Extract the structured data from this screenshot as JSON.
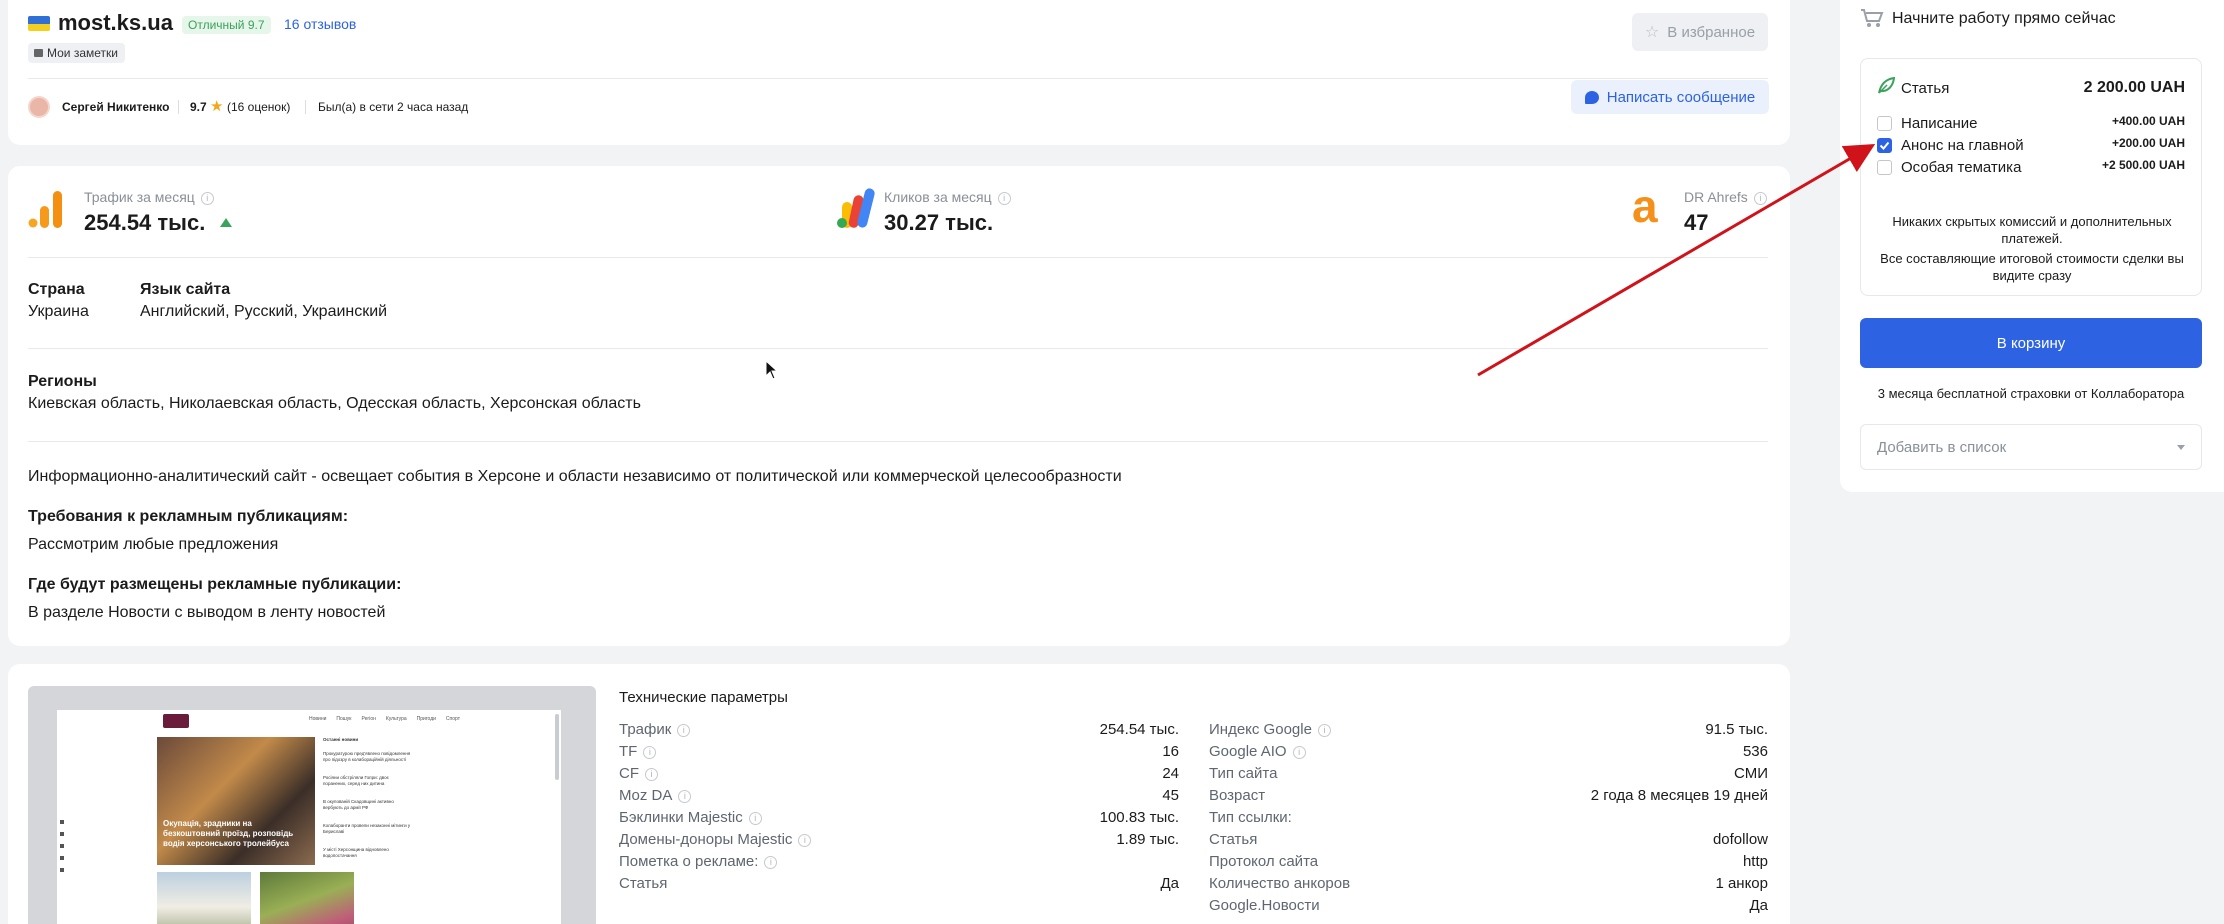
{
  "site": {
    "name": "most.ks.ua",
    "rating_badge": "Отличный 9.7",
    "reviews_link": "16 отзывов",
    "notes_label": "Мои заметки",
    "favorite_button": "В избранное",
    "colors": {
      "accent": "#2d63e2",
      "badge_bg": "#e6f6ea",
      "badge_text": "#3aa25a"
    }
  },
  "owner": {
    "name": "Сергей Никитенко",
    "rating": "9.7",
    "rating_count": "(16 оценок)",
    "last_seen": "Был(а) в сети 2 часа назад",
    "message_button": "Написать сообщение"
  },
  "stats": [
    {
      "label": "Трафик за месяц",
      "value": "254.54 тыс.",
      "trend": "up"
    },
    {
      "label": "Кликов за месяц",
      "value": "30.27 тыс."
    },
    {
      "label": "DR Ahrefs",
      "value": "47"
    }
  ],
  "details": {
    "country_label": "Страна",
    "country_value": "Украина",
    "language_label": "Язык сайта",
    "language_value": "Английский, Русский, Украинский",
    "regions_label": "Регионы",
    "regions_value": "Киевская область, Николаевская область, Одесская область, Херсонская область",
    "description": "Информационно-аналитический сайт - освещает события в Херсоне и области независимо от политической или коммерческой целесообразности",
    "requirements_label": "Требования к рекламным публикациям:",
    "requirements_value": "Рассмотрим любые предложения",
    "placement_label": "Где будут размещены рекламные публикации:",
    "placement_value": "В разделе Новости с выводом в ленту новостей"
  },
  "tech": {
    "title": "Технические параметры",
    "left": [
      {
        "label": "Трафик",
        "value": "254.54 тыс.",
        "info": true
      },
      {
        "label": "TF",
        "value": "16",
        "info": true
      },
      {
        "label": "CF",
        "value": "24",
        "info": true
      },
      {
        "label": "Moz DA",
        "value": "45",
        "info": true
      },
      {
        "label": "Бэклинки Majestic",
        "value": "100.83 тыс.",
        "info": true
      },
      {
        "label": "Домены-доноры Majestic",
        "value": "1.89 тыс.",
        "info": true
      },
      {
        "label": "Пометка о рекламе:",
        "value": "",
        "info": true
      },
      {
        "label": "Статья",
        "value": "Да",
        "info": false
      }
    ],
    "right": [
      {
        "label": "Индекс Google",
        "value": "91.5 тыс.",
        "info": true
      },
      {
        "label": "Google AIO",
        "value": "536",
        "info": true
      },
      {
        "label": "Тип сайта",
        "value": "СМИ",
        "info": false
      },
      {
        "label": "Возраст",
        "value": "2 года 8 месяцев 19 дней",
        "info": false
      },
      {
        "label": "Тип ссылки:",
        "value": "",
        "info": false
      },
      {
        "label": "Статья",
        "value": "dofollow",
        "info": false
      },
      {
        "label": "Протокол сайта",
        "value": "http",
        "info": false
      },
      {
        "label": "Количество анкоров",
        "value": "1 анкор",
        "info": false
      },
      {
        "label": "Google.Новости",
        "value": "Да",
        "info": false
      }
    ]
  },
  "preview": {
    "nav": [
      "Новини",
      "Пошук",
      "Регіон",
      "Культура",
      "Пригоди",
      "Спорт"
    ],
    "headline": "Окупація, зрадники на безкоштовний проїзд, розповідь водія херсонського тролейбуса",
    "side_title": "Останні новини",
    "side_items": [
      "Прокуратурою пред'явлено повідомлення про підозру в колабораційній діяльності",
      "Росіяни обстріляли Гопри: двоє поранених, серед них дитина",
      "В окупованій Скадовщині активно вербують до армії РФ",
      "Колаборанти провели незаконні мітинги у Бериславі",
      "У місті Херсонщина відновлено водопостачання"
    ]
  },
  "cart": {
    "header": "Начните работу прямо сейчас",
    "article_label": "Статья",
    "article_price": "2 200.00 UAH",
    "options": [
      {
        "label": "Написание",
        "price": "+400.00 UAH",
        "checked": false
      },
      {
        "label": "Анонс на главной",
        "price": "+200.00 UAH",
        "checked": true
      },
      {
        "label": "Особая тематика",
        "price": "+2 500.00 UAH",
        "checked": false
      }
    ],
    "note_line1": "Никаких скрытых комиссий и дополнительных платежей.",
    "note_line2": "Все составляющие итоговой стоимости сделки вы видите сразу",
    "cta_button": "В корзину",
    "insurance": "3 месяца бесплатной страховки от Коллаборатора",
    "list_placeholder": "Добавить в список"
  }
}
